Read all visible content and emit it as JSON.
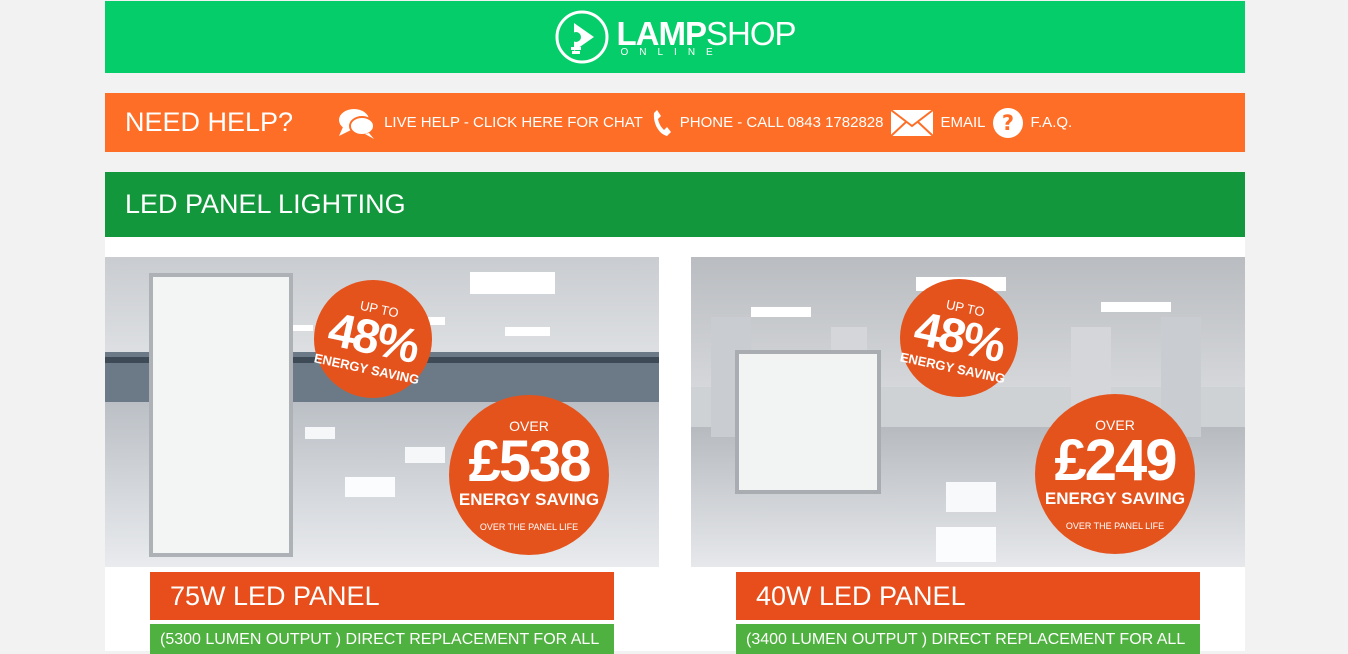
{
  "header": {
    "logo_bold": "LAMP",
    "logo_light": "SHOP",
    "logo_sub": "ONLINE"
  },
  "help": {
    "title": "NEED HELP?",
    "live_help": "LIVE HELP - CLICK HERE FOR CHAT",
    "phone": "PHONE - CALL 0843 1782828",
    "email": "EMAIL",
    "faq": "F.A.Q."
  },
  "section": {
    "title": "LED PANEL LIGHTING"
  },
  "products": [
    {
      "badge_pct_top": "UP TO",
      "badge_pct_value": "48%",
      "badge_pct_bottom": "ENERGY SAVING",
      "badge_money_top": "OVER",
      "badge_money_value": "£538",
      "badge_money_mid": "ENERGY SAVING",
      "badge_money_bottom": "OVER THE PANEL LIFE",
      "title": "75W LED PANEL",
      "description": "(5300 LUMEN OUTPUT ) DIRECT REPLACEMENT FOR ALL"
    },
    {
      "badge_pct_top": "UP TO",
      "badge_pct_value": "48%",
      "badge_pct_bottom": "ENERGY SAVING",
      "badge_money_top": "OVER",
      "badge_money_value": "£249",
      "badge_money_mid": "ENERGY SAVING",
      "badge_money_bottom": "OVER THE PANEL LIFE",
      "title": "40W LED PANEL",
      "description": "(3400 LUMEN OUTPUT ) DIRECT REPLACEMENT FOR ALL"
    }
  ],
  "colors": {
    "header_green": "#04cd6a",
    "help_orange": "#ff6e26",
    "section_green": "#12973c",
    "badge_orange": "#e5531d",
    "title_orange": "#e84e1b",
    "desc_green": "#4fb13f"
  }
}
